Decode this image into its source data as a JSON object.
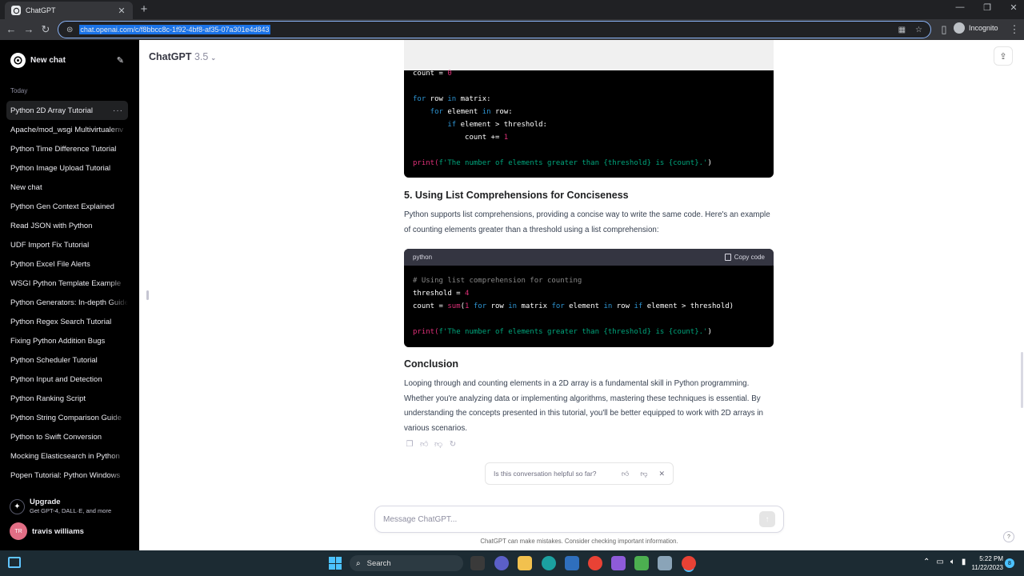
{
  "browser": {
    "tab_title": "ChatGPT",
    "url": "chat.openai.com/c/f8bbcc8c-1f92-4bf8-af35-07a301e4d843",
    "incognito_label": "Incognito"
  },
  "sidebar": {
    "new_chat_label": "New chat",
    "section_label": "Today",
    "items": [
      {
        "label": "Python 2D Array Tutorial"
      },
      {
        "label": "Apache/mod_wsgi Multivirtualenv"
      },
      {
        "label": "Python Time Difference Tutorial"
      },
      {
        "label": "Python Image Upload Tutorial"
      },
      {
        "label": "New chat"
      },
      {
        "label": "Python Gen Context Explained"
      },
      {
        "label": "Read JSON with Python"
      },
      {
        "label": "UDF Import Fix Tutorial"
      },
      {
        "label": "Python Excel File Alerts"
      },
      {
        "label": "WSGI Python Template Example"
      },
      {
        "label": "Python Generators: In-depth Guide"
      },
      {
        "label": "Python Regex Search Tutorial"
      },
      {
        "label": "Fixing Python Addition Bugs"
      },
      {
        "label": "Python Scheduler Tutorial"
      },
      {
        "label": "Python Input and Detection"
      },
      {
        "label": "Python Ranking Script"
      },
      {
        "label": "Python String Comparison Guide"
      },
      {
        "label": "Python to Swift Conversion"
      },
      {
        "label": "Mocking Elasticsearch in Python"
      },
      {
        "label": "Popen Tutorial: Python Windows"
      }
    ],
    "upgrade_title": "Upgrade",
    "upgrade_subtitle": "Get GPT-4, DALL·E, and more",
    "user_initials": "TR",
    "user_name": "travis williams"
  },
  "header": {
    "model_name": "ChatGPT",
    "model_version": "3.5"
  },
  "message": {
    "code_top": {
      "lines": [
        [
          "count = ",
          "0"
        ],
        [
          "for",
          " row ",
          "in",
          " matrix:"
        ],
        [
          "    for",
          " element ",
          "in",
          " row:"
        ],
        [
          "        if",
          " element > threshold:"
        ],
        [
          "            count += ",
          "1"
        ],
        [
          "print(",
          "f'The number of elements greater than {threshold} is {count}.'",
          ")"
        ]
      ]
    },
    "section5_heading": "5. Using List Comprehensions for Conciseness",
    "section5_text": "Python supports list comprehensions, providing a concise way to write the same code. Here's an example of counting elements greater than a threshold using a list comprehension:",
    "code_block": {
      "language": "python",
      "copy_label": "Copy code",
      "comment": "# Using list comprehension for counting",
      "line_threshold": [
        "threshold = ",
        "4"
      ],
      "line_count": {
        "a": "count = ",
        "b": "sum",
        "c": "(",
        "d": "1",
        "e": " ",
        "f": "for",
        "g": " row ",
        "h": "in",
        "i": " matrix ",
        "j": "for",
        "k": " element ",
        "l": "in",
        "m": " row ",
        "n": "if",
        "o": " element > threshold)"
      },
      "line_print": [
        "print(",
        "f'The number of elements greater than {threshold} is {count}.'",
        ")"
      ]
    },
    "conclusion_heading": "Conclusion",
    "conclusion_text": "Looping through and counting elements in a 2D array is a fundamental skill in Python programming. Whether you're analyzing data or implementing algorithms, mastering these techniques is essential. By understanding the concepts presented in this tutorial, you'll be better equipped to work with 2D arrays in various scenarios."
  },
  "feedback": {
    "question": "Is this conversation helpful so far?"
  },
  "composer": {
    "placeholder": "Message ChatGPT...",
    "disclaimer": "ChatGPT can make mistakes. Consider checking important information."
  },
  "taskbar": {
    "search_label": "Search",
    "time": "5:22 PM",
    "date": "11/22/2023",
    "notification_count": "8"
  }
}
